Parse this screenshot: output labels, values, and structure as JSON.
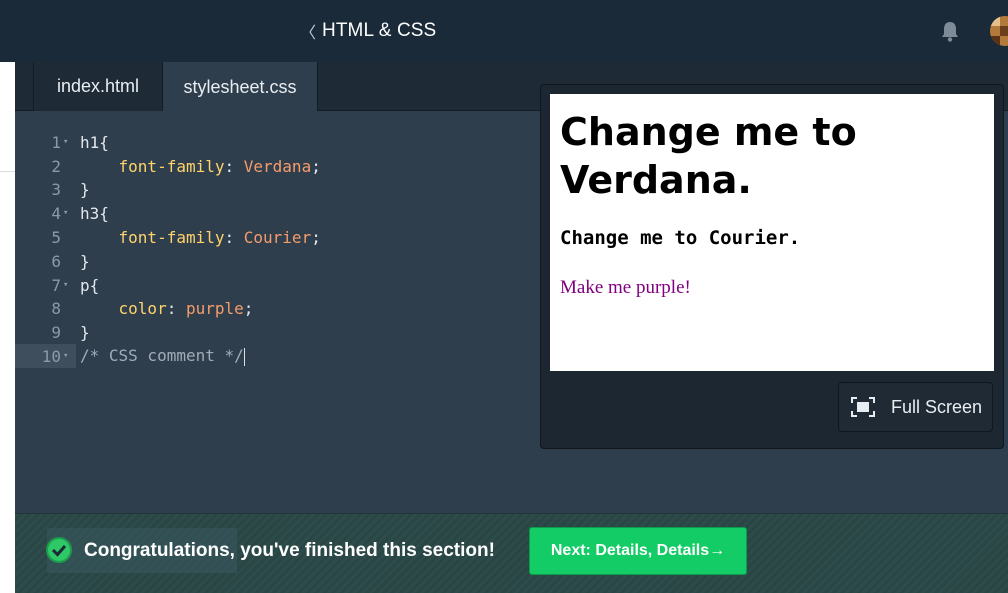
{
  "header": {
    "back_chevron": "〈",
    "course_title": "HTML & CSS",
    "icons": [
      "bell-icon",
      "avatar"
    ]
  },
  "tabs": [
    {
      "label": "index.html",
      "active": false
    },
    {
      "label": "stylesheet.css",
      "active": true
    }
  ],
  "editor": {
    "lines": [
      {
        "num": "1",
        "fold": "▾",
        "selector": "h1{"
      },
      {
        "num": "2",
        "fold": "",
        "property": "font-family",
        "value": "Verdana"
      },
      {
        "num": "3",
        "fold": "",
        "selector": "}"
      },
      {
        "num": "4",
        "fold": "▾",
        "selector": "h3{"
      },
      {
        "num": "5",
        "fold": "",
        "property": "font-family",
        "value": "Courier"
      },
      {
        "num": "6",
        "fold": "",
        "selector": "}"
      },
      {
        "num": "7",
        "fold": "▾",
        "selector": "p{"
      },
      {
        "num": "8",
        "fold": "",
        "property": "color",
        "value": "purple"
      },
      {
        "num": "9",
        "fold": "",
        "selector": "}"
      },
      {
        "num": "10",
        "fold": "▾",
        "comment": "/* CSS comment */"
      }
    ],
    "active_line": "10"
  },
  "preview": {
    "h1": "Change me to Verdana.",
    "h3": "Change me to Courier.",
    "p": "Make me purple!",
    "fullscreen_label": "Full Screen"
  },
  "footer": {
    "message": "Congratulations, you've finished this section!",
    "next_label": "Next: Details, Details→"
  },
  "colors": {
    "topbar": "#1b2a38",
    "editor_bg": "#2f3e4d",
    "property": "#ffd36b",
    "value": "#f59c6b",
    "success_green": "#14cc66",
    "purple_text": "#800080"
  }
}
